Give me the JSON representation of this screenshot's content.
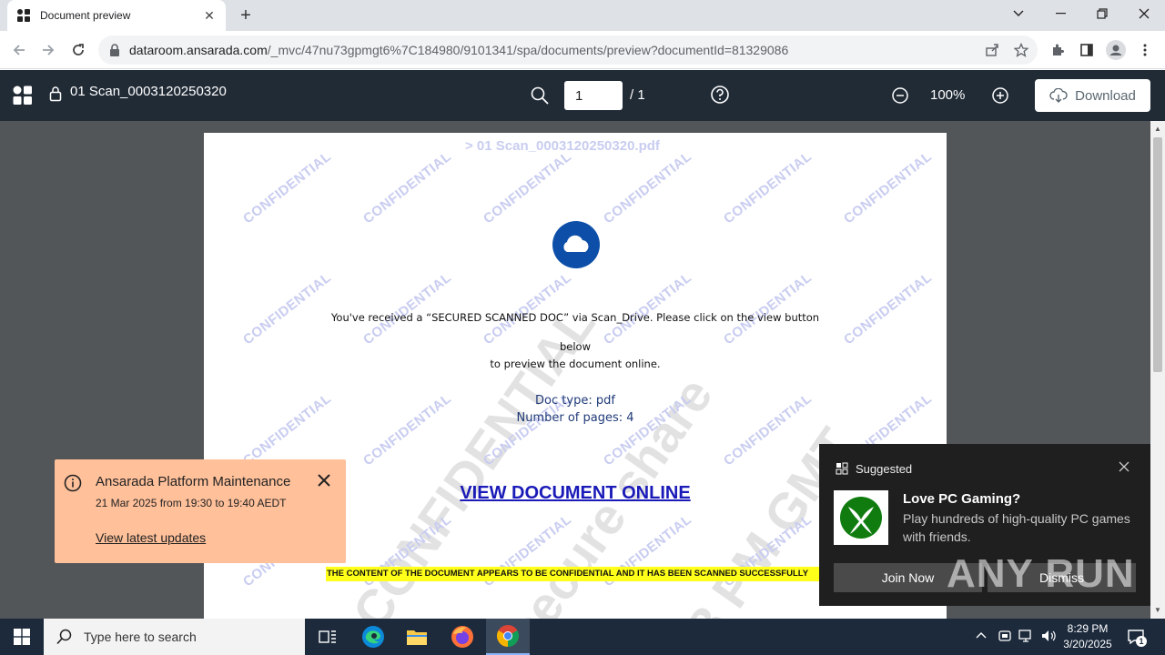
{
  "browser": {
    "tab_title": "Document preview",
    "url_domain": "dataroom.ansarada.com",
    "url_path": "/_mvc/47nu73gpmgt6%7C184980/9101341/spa/documents/preview?documentId=81329086"
  },
  "viewer": {
    "filename": "01 Scan_0003120250320",
    "page_current": "1",
    "page_total": "/ 1",
    "zoom": "100%",
    "download_label": "Download"
  },
  "document": {
    "header": "> 01 Scan_0003120250320.pdf",
    "watermark": "CONFIDENTIAL",
    "big_watermark_1": "CONFIDENTIAL",
    "big_watermark_2": "secure share",
    "big_watermark_3": "28 PM GMT",
    "line1": "You've received a “SECURED SCANNED DOC” via Scan_Drive. Please click on the view button",
    "line2": "below",
    "line3": "to preview the document online.",
    "doc_type": "Doc type: pdf",
    "num_pages": "Number of pages: 4",
    "link": "VIEW DOCUMENT ONLINE",
    "highlight": "THE CONTENT OF THE DOCUMENT APPEARS TO BE CONFIDENTIAL AND IT HAS BEEN SCANNED SUCCESSFULLY"
  },
  "maintenance": {
    "title": "Ansarada Platform Maintenance",
    "time": "21 Mar 2025 from 19:30 to 19:40 AEDT",
    "link": "View latest updates"
  },
  "notification": {
    "app": "Suggested",
    "title": "Love PC Gaming?",
    "body": "Play hundreds of high-quality PC games with friends.",
    "join": "Join Now",
    "dismiss": "Dismiss"
  },
  "watermark_brand": "ANY RUN",
  "taskbar": {
    "search_placeholder": "Type here to search",
    "time": "8:29 PM",
    "date": "3/20/2025",
    "notif_count": "1"
  },
  "colors": {
    "viewer_header": "#212b36",
    "doc_background": "#525659",
    "toast": "#ffc09a",
    "highlight": "#ffff1a",
    "link": "#1a1ab8"
  }
}
